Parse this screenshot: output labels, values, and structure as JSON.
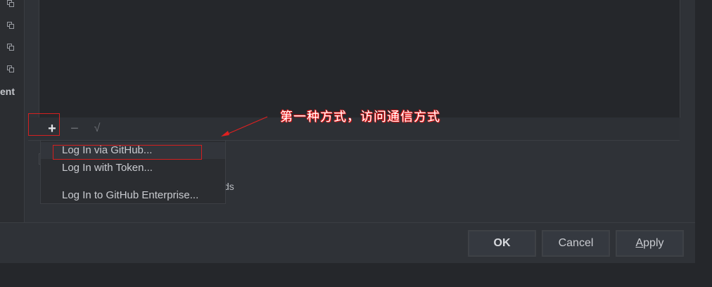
{
  "sidebar": {
    "partial_label": "ent",
    "copy_icons": [
      "copy-icon",
      "copy-icon",
      "copy-icon",
      "copy-icon"
    ]
  },
  "toolbar": {
    "add_symbol": "+",
    "remove_symbol": "−",
    "check_symbol": "√"
  },
  "behind_text": "ds",
  "popup_menu": {
    "items": [
      {
        "label": "Log In via GitHub..."
      },
      {
        "label": "Log In with Token..."
      },
      {
        "label": "Log In to GitHub Enterprise..."
      }
    ]
  },
  "annotation": {
    "text": "第一种方式，访问通信方式",
    "color": "#ff2a2a"
  },
  "buttons": {
    "ok": "OK",
    "cancel": "Cancel",
    "apply_first": "A",
    "apply_rest": "pply"
  }
}
